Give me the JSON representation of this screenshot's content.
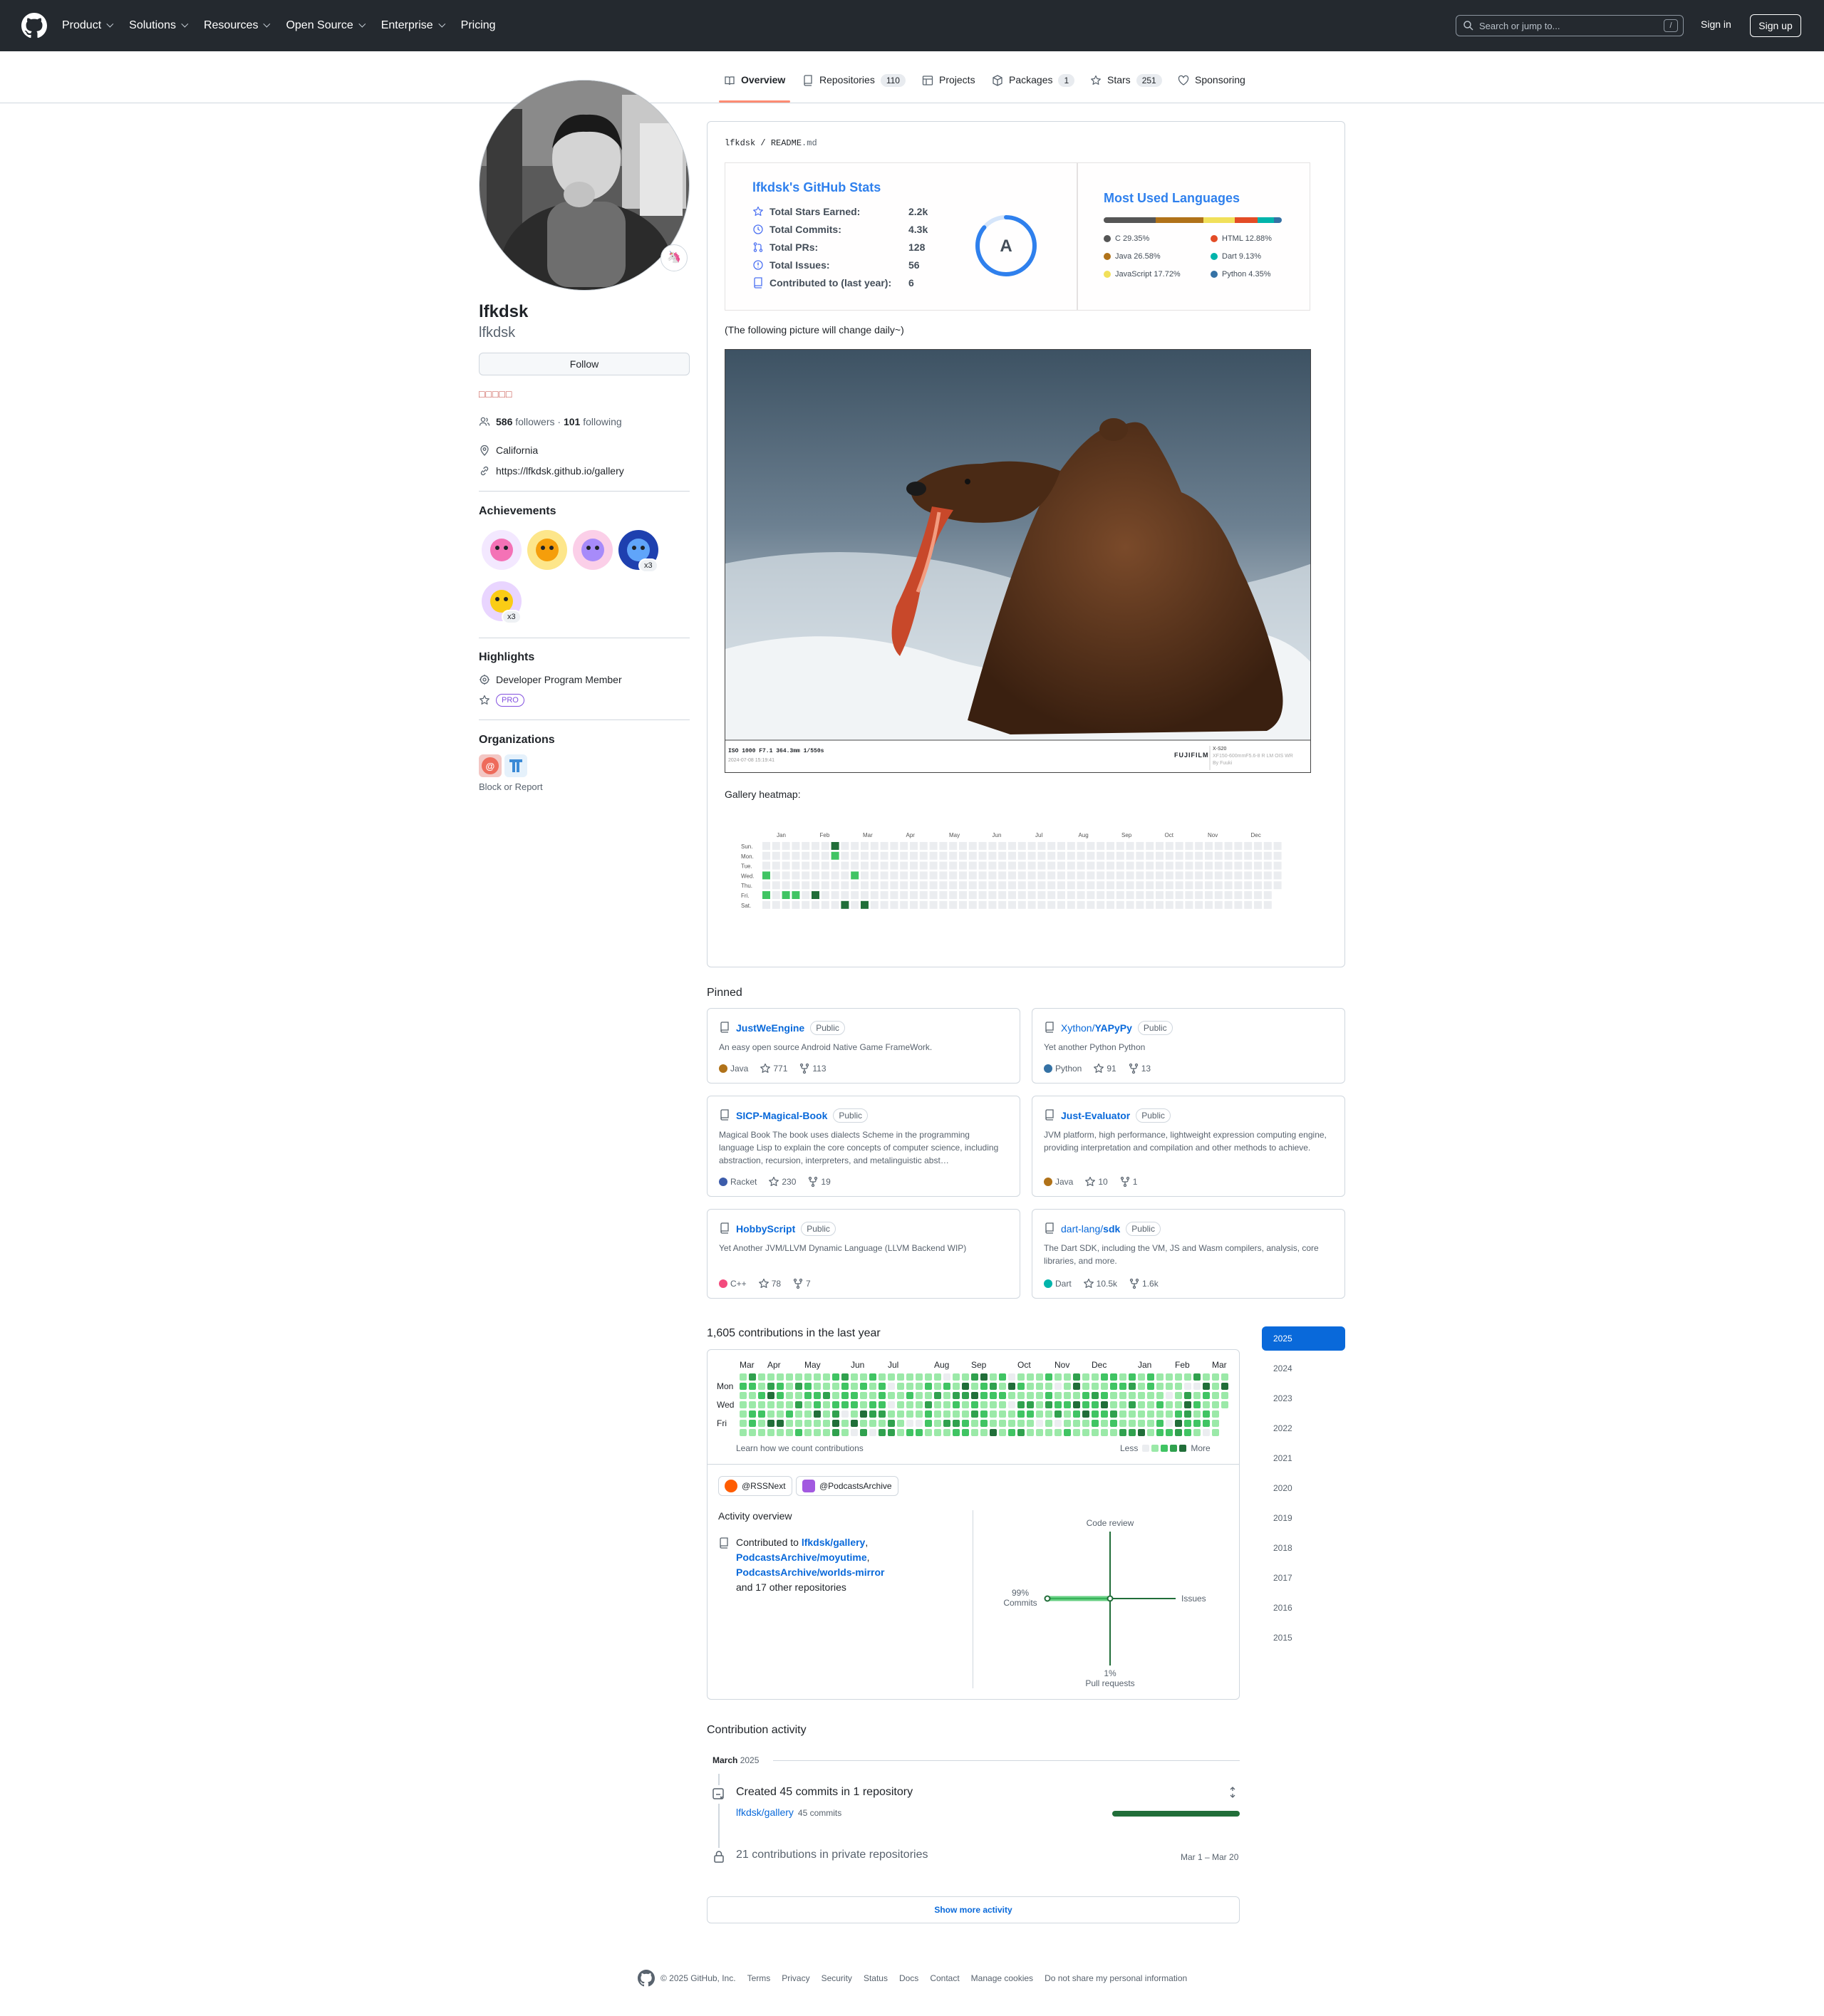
{
  "header": {
    "nav": [
      "Product",
      "Solutions",
      "Resources",
      "Open Source",
      "Enterprise",
      "Pricing"
    ],
    "nav_has_chevron": [
      true,
      true,
      true,
      true,
      true,
      false
    ],
    "search_placeholder": "Search or jump to...",
    "search_shortcut": "/",
    "sign_in": "Sign in",
    "sign_up": "Sign up"
  },
  "tabs": [
    {
      "label": "Overview",
      "count": "",
      "icon": "book-icon",
      "active": true
    },
    {
      "label": "Repositories",
      "count": "110",
      "icon": "repo-icon",
      "active": false
    },
    {
      "label": "Projects",
      "count": "",
      "icon": "table-icon",
      "active": false
    },
    {
      "label": "Packages",
      "count": "1",
      "icon": "package-icon",
      "active": false
    },
    {
      "label": "Stars",
      "count": "251",
      "icon": "star-icon",
      "active": false
    },
    {
      "label": "Sponsoring",
      "count": "",
      "icon": "heart-icon",
      "active": false
    }
  ],
  "profile": {
    "name": "lfkdsk",
    "login": "lfkdsk",
    "status_emoji": "🦄",
    "follow_label": "Follow",
    "emoji_boxes": "□□□□□",
    "followers": "586",
    "followers_label": "followers",
    "following": "101",
    "following_label": "following",
    "location": "California",
    "website": "https://lfkdsk.github.io/gallery"
  },
  "achievements": {
    "title": "Achievements",
    "badges": [
      {
        "icon": "heart-on-sleeve-icon",
        "count": ""
      },
      {
        "icon": "pull-shark-bear-icon",
        "count": ""
      },
      {
        "icon": "yolo-icon",
        "count": ""
      },
      {
        "icon": "pull-shark-icon",
        "count": "x3"
      },
      {
        "icon": "starstruck-icon",
        "count": "x3"
      }
    ]
  },
  "highlights": {
    "title": "Highlights",
    "developer": "Developer Program Member",
    "pro": "PRO"
  },
  "organizations": {
    "title": "Organizations",
    "block_report": "Block or Report"
  },
  "readme": {
    "path_user": "lfkdsk",
    "path_sep": "/",
    "path_file": "README",
    "path_ext": ".md",
    "stats": {
      "title": "lfkdsk's GitHub Stats",
      "rows": [
        {
          "label": "Total Stars Earned:",
          "value": "2.2k",
          "icon": "star-icon"
        },
        {
          "label": "Total Commits:",
          "value": "4.3k",
          "icon": "history-icon"
        },
        {
          "label": "Total PRs:",
          "value": "128",
          "icon": "pr-icon"
        },
        {
          "label": "Total Issues:",
          "value": "56",
          "icon": "issue-icon"
        },
        {
          "label": "Contributed to (last year):",
          "value": "6",
          "icon": "repo-icon"
        }
      ],
      "rank": "A",
      "rank_progress": 0.86
    },
    "languages": {
      "title": "Most Used Languages",
      "items": [
        {
          "name": "C",
          "percent": 29.35,
          "label": "C 29.35%",
          "color": "#555555"
        },
        {
          "name": "Java",
          "percent": 26.58,
          "label": "Java 26.58%",
          "color": "#b07219"
        },
        {
          "name": "JavaScript",
          "percent": 17.72,
          "label": "JavaScript 17.72%",
          "color": "#f1e05a"
        },
        {
          "name": "HTML",
          "percent": 12.88,
          "label": "HTML 12.88%",
          "color": "#e34c26"
        },
        {
          "name": "Dart",
          "percent": 9.13,
          "label": "Dart 9.13%",
          "color": "#00b4ab"
        },
        {
          "name": "Python",
          "percent": 4.35,
          "label": "Python 4.35%",
          "color": "#3572a5"
        }
      ]
    },
    "change_note": "(The following picture will change daily~)",
    "photo": {
      "exposure": "ISO 1000 F7.1 364.3mm 1/550s",
      "date": "2024-07-08 15:19:41",
      "brand": "FUJIFILM",
      "model": "X-S20",
      "lens": "XF150-600mmF5.6-8 R LM OIS WR",
      "credit": "By Fuuki"
    },
    "gallery_label": "Gallery heatmap:",
    "gallery_heatmap": {
      "months": [
        "Jan",
        "Feb",
        "Mar",
        "Apr",
        "May",
        "Jun",
        "Jul",
        "Aug",
        "Sep",
        "Oct",
        "Nov",
        "Dec"
      ],
      "days": [
        "Sun.",
        "Mon.",
        "Tue.",
        "Wed.",
        "Thu.",
        "Fri.",
        "Sat."
      ],
      "active": [
        {
          "week": 7,
          "day": 0,
          "level": 4
        },
        {
          "week": 7,
          "day": 1,
          "level": 2
        },
        {
          "week": 9,
          "day": 3,
          "level": 2
        },
        {
          "week": 0,
          "day": 3,
          "level": 2
        },
        {
          "week": 0,
          "day": 5,
          "level": 2
        },
        {
          "week": 2,
          "day": 5,
          "level": 2
        },
        {
          "week": 3,
          "day": 5,
          "level": 2
        },
        {
          "week": 5,
          "day": 5,
          "level": 4
        },
        {
          "week": 8,
          "day": 6,
          "level": 4
        },
        {
          "week": 10,
          "day": 6,
          "level": 4
        }
      ]
    }
  },
  "pinned": {
    "title": "Pinned",
    "items": [
      {
        "owner": "",
        "name": "JustWeEngine",
        "visibility": "Public",
        "description": "An easy open source Android Native Game FrameWork.",
        "language": "Java",
        "language_color": "#b07219",
        "stars": "771",
        "forks": "113"
      },
      {
        "owner": "Xython/",
        "name": "YAPyPy",
        "visibility": "Public",
        "description": "Yet another Python Python",
        "language": "Python",
        "language_color": "#3572a5",
        "stars": "91",
        "forks": "13"
      },
      {
        "owner": "",
        "name": "SICP-Magical-Book",
        "visibility": "Public",
        "description": "Magical Book The book uses dialects Scheme in the programming language Lisp to explain the core concepts of computer science, including abstraction, recursion, interpreters, and metalinguistic abst…",
        "language": "Racket",
        "language_color": "#3c5caa",
        "stars": "230",
        "forks": "19"
      },
      {
        "owner": "",
        "name": "Just-Evaluator",
        "visibility": "Public",
        "description": "JVM platform, high performance, lightweight expression computing engine, providing interpretation and compilation and other methods to achieve.",
        "language": "Java",
        "language_color": "#b07219",
        "stars": "10",
        "forks": "1"
      },
      {
        "owner": "",
        "name": "HobbyScript",
        "visibility": "Public",
        "description": "Yet Another JVM/LLVM Dynamic Language (LLVM Backend WIP)",
        "language": "C++",
        "language_color": "#f34b7d",
        "stars": "78",
        "forks": "7"
      },
      {
        "owner": "dart-lang/",
        "name": "sdk",
        "visibility": "Public",
        "description": "The Dart SDK, including the VM, JS and Wasm compilers, analysis, core libraries, and more.",
        "language": "Dart",
        "language_color": "#00b4ab",
        "stars": "10.5k",
        "forks": "1.6k"
      }
    ]
  },
  "contributions": {
    "title": "1,605 contributions in the last year",
    "months": [
      "Mar",
      "Apr",
      "May",
      "Jun",
      "Jul",
      "Aug",
      "Sep",
      "Oct",
      "Nov",
      "Dec",
      "Jan",
      "Feb",
      "Mar"
    ],
    "days": [
      "Mon",
      "Wed",
      "Fri"
    ],
    "learn": "Learn how we count contributions",
    "less": "Less",
    "more": "More",
    "level_colors": [
      "#ebedf0",
      "#9be9a8",
      "#40c463",
      "#30a14e",
      "#216e39"
    ],
    "orgs": [
      "@RSSNext",
      "@PodcastsArchive"
    ],
    "activity_overview": "Activity overview",
    "contributed_to": "Contributed to",
    "repos": [
      "lfkdsk/gallery",
      "PodcastsArchive/moyutime",
      "PodcastsArchive/worlds-mirror"
    ],
    "and_other": "and 17 other repositories",
    "overview": {
      "code_review": "Code review",
      "issues": "Issues",
      "commits_pct": "99%",
      "commits": "Commits",
      "prs_pct": "1%",
      "prs": "Pull requests"
    }
  },
  "years": [
    "2025",
    "2024",
    "2023",
    "2022",
    "2021",
    "2020",
    "2019",
    "2018",
    "2017",
    "2016",
    "2015"
  ],
  "activity": {
    "title": "Contribution activity",
    "month": "March",
    "year": "2025",
    "commits_summary": "Created 45 commits in 1 repository",
    "repo": "lfkdsk/gallery",
    "repo_commits": "45 commits",
    "private_summary": "21 contributions in private repositories",
    "private_dates": "Mar 1 – Mar 20",
    "show_more": "Show more activity"
  },
  "footer": {
    "copyright": "© 2025 GitHub, Inc.",
    "links": [
      "Terms",
      "Privacy",
      "Security",
      "Status",
      "Docs",
      "Contact",
      "Manage cookies",
      "Do not share my personal information"
    ]
  }
}
